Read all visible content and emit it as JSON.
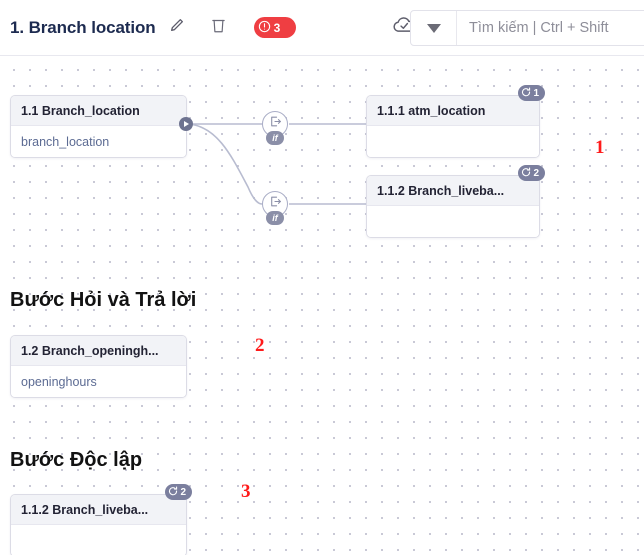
{
  "header": {
    "title": "1. Branch location",
    "edit_icon": "pencil-icon",
    "delete_icon": "trash-icon",
    "error_badge": {
      "icon": "alert-circle-icon",
      "count": "3"
    },
    "cloud_icon": "cloud-check-icon",
    "dropdown_icon": "caret-down-icon",
    "search": {
      "placeholder": "Tìm kiếm | Ctrl + Shift",
      "value": ""
    }
  },
  "canvas": {
    "sections": [
      {
        "heading": "Bước Hỏi và Trả lời"
      },
      {
        "heading": "Bước Độc lập"
      }
    ],
    "nodes": [
      {
        "title": "1.1 Branch_location",
        "subtitle": "branch_location",
        "badge": ""
      },
      {
        "title": "1.1.1 atm_location",
        "subtitle": "",
        "badge": "1"
      },
      {
        "title": "1.1.2 Branch_liveba...",
        "subtitle": "",
        "badge": "2"
      },
      {
        "title": "1.2 Branch_openingh...",
        "subtitle": "openinghours",
        "badge": ""
      },
      {
        "title": "1.1.2 Branch_liveba...",
        "subtitle": "",
        "badge": "2"
      }
    ],
    "conditions": [
      {
        "label": "if"
      },
      {
        "label": "if"
      }
    ],
    "markers": [
      "1",
      "2",
      "3"
    ],
    "colors": {
      "marker": "#ff1a1a",
      "error_badge": "#ef3e42",
      "loop_badge": "#7b7f9e",
      "node_header": "#f2f3f7",
      "node_subtitle": "#5c6b93",
      "title": "#1d2b50"
    }
  }
}
